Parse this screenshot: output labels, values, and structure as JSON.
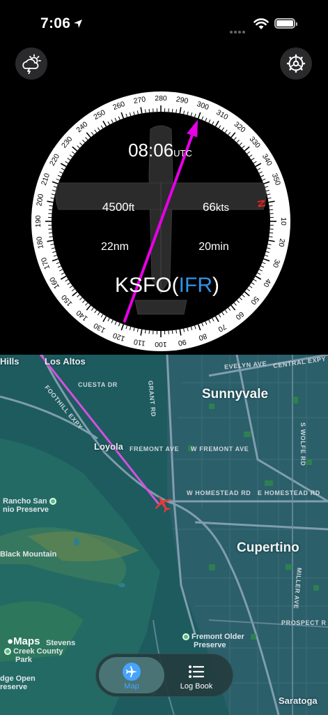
{
  "status_bar": {
    "time": "7:06"
  },
  "header": {
    "weather_button_icon": "cloud-sun-lightning-icon",
    "settings_button_icon": "gear-icon"
  },
  "compass": {
    "heading_labels": [
      "0",
      "10",
      "20",
      "30",
      "40",
      "50",
      "60",
      "70",
      "80",
      "90",
      "100",
      "110",
      "120",
      "130",
      "140",
      "150",
      "160",
      "170",
      "180",
      "190",
      "200",
      "210",
      "220",
      "230",
      "240",
      "250",
      "260",
      "270",
      "280",
      "290",
      "300",
      "310",
      "320",
      "330",
      "340",
      "350"
    ],
    "north_label": "N",
    "course_deg": 300,
    "time": "08:06",
    "time_unit": "UTC",
    "altitude": "4500",
    "altitude_unit": "ft",
    "speed": "66",
    "speed_unit": "kts",
    "distance": "22",
    "distance_unit": "nm",
    "time_remaining": "20",
    "time_remaining_unit": "min",
    "airport": "KSFO",
    "flight_rule": "IFR",
    "colors": {
      "course_line": "#e600e6",
      "north": "#e52222",
      "flight_rule": "#2f93e8"
    }
  },
  "map": {
    "cities": {
      "sunnyvale": "Sunnyvale",
      "cupertino": "Cupertino",
      "los_altos": "Los Altos",
      "loyola": "Loyola",
      "saratoga": "Saratoga",
      "hills": "Hills"
    },
    "streets": {
      "foothill": "FOOTHILL EXPY",
      "cuesta": "CUESTA DR",
      "grant": "GRANT RD",
      "fremont1": "FREMONT AVE",
      "fremont2": "W FREMONT AVE",
      "homestead1": "W HOMESTEAD RD",
      "homestead2": "E HOMESTEAD RD",
      "evelyn": "EVELYN AVE",
      "central": "CENTRAL EXPY",
      "wolfe": "S WOLFE RD",
      "miller": "MILLER AVE",
      "prospect": "PROSPECT R"
    },
    "pois": {
      "rancho1": "Rancho San",
      "rancho2": "nio Preserve",
      "black_mountain": "Black Mountain",
      "stevens1": "Stevens",
      "stevens2": "Creek County",
      "stevens3": "Park",
      "fremont_older1": "Fremont Older",
      "fremont_older2": "Preserve",
      "ridge1": "dge Open",
      "ridge2": "reserve"
    },
    "attribution": "Maps",
    "colors": {
      "water": "#2e7f8b",
      "land": "#1d5b5e",
      "route": "#d64fe0",
      "plane": "#e63a3a"
    }
  },
  "tab_bar": {
    "tabs": [
      {
        "label": "Map",
        "icon": "airplane-circle-icon",
        "active": true
      },
      {
        "label": "Log Book",
        "icon": "list-icon",
        "active": false
      }
    ]
  }
}
